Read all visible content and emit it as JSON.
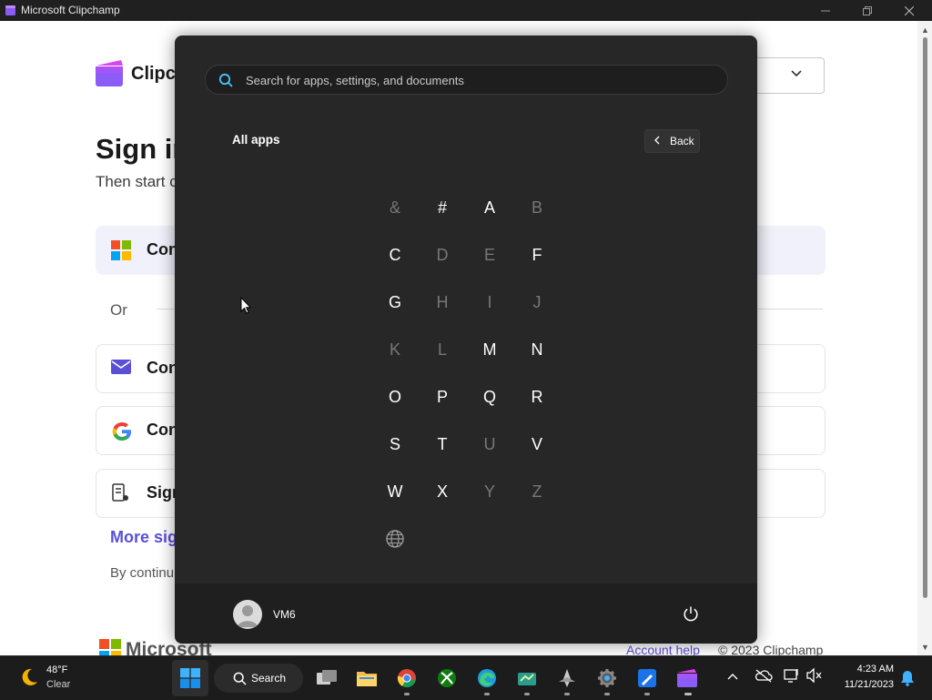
{
  "window": {
    "title": "Microsoft Clipchamp"
  },
  "background_page": {
    "brand": "Clipch",
    "heading": "Sign in",
    "subheading": "Then start c",
    "or": "Or",
    "rows": [
      {
        "label": "Con",
        "icon": "microsoft-icon"
      },
      {
        "label": "Con",
        "icon": "mail-icon"
      },
      {
        "label": "Con",
        "icon": "google-icon"
      },
      {
        "label": "Sign",
        "icon": "badge-icon"
      }
    ],
    "more_sign": "More sig",
    "by_continuing": "By continu",
    "footer_ms": "Microsoft",
    "footer_account_help": "Account help",
    "footer_copyright": "© 2023 Clipchamp"
  },
  "start_menu": {
    "search_placeholder": "Search for apps, settings, and documents",
    "section_title": "All apps",
    "back_label": "Back",
    "letters": [
      {
        "char": "&",
        "enabled": false
      },
      {
        "char": "#",
        "enabled": true
      },
      {
        "char": "A",
        "enabled": true
      },
      {
        "char": "B",
        "enabled": false
      },
      {
        "char": "C",
        "enabled": true
      },
      {
        "char": "D",
        "enabled": false
      },
      {
        "char": "E",
        "enabled": false
      },
      {
        "char": "F",
        "enabled": true
      },
      {
        "char": "G",
        "enabled": true
      },
      {
        "char": "H",
        "enabled": false
      },
      {
        "char": "I",
        "enabled": false
      },
      {
        "char": "J",
        "enabled": false
      },
      {
        "char": "K",
        "enabled": false
      },
      {
        "char": "L",
        "enabled": false
      },
      {
        "char": "M",
        "enabled": true
      },
      {
        "char": "N",
        "enabled": true
      },
      {
        "char": "O",
        "enabled": true
      },
      {
        "char": "P",
        "enabled": true
      },
      {
        "char": "Q",
        "enabled": true
      },
      {
        "char": "R",
        "enabled": true
      },
      {
        "char": "S",
        "enabled": true
      },
      {
        "char": "T",
        "enabled": true
      },
      {
        "char": "U",
        "enabled": false
      },
      {
        "char": "V",
        "enabled": true
      },
      {
        "char": "W",
        "enabled": true
      },
      {
        "char": "X",
        "enabled": true
      },
      {
        "char": "Y",
        "enabled": false
      },
      {
        "char": "Z",
        "enabled": false
      }
    ],
    "user_name": "VM6"
  },
  "taskbar": {
    "weather_temp": "48°F",
    "weather_condition": "Clear",
    "search_label": "Search",
    "apps": [
      "start-icon",
      "task-view-icon",
      "file-explorer-icon",
      "chrome-icon",
      "xbox-icon",
      "edge-icon",
      "app-icon",
      "app-icon",
      "settings-icon",
      "app-icon",
      "clipchamp-icon"
    ],
    "time": "4:23 AM",
    "date": "11/21/2023"
  },
  "colors": {
    "accent": "#5b4fd6",
    "start_bg": "#272727",
    "taskbar_bg": "#1c1c1c"
  }
}
